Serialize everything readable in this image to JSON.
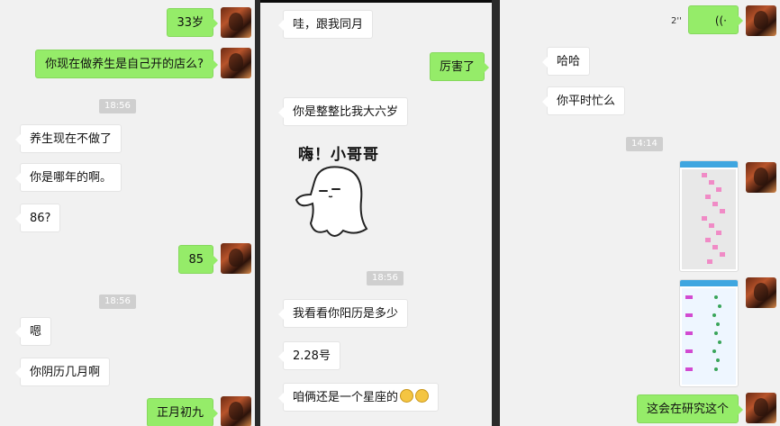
{
  "panel1": {
    "messages": [
      {
        "text": "33岁",
        "dir": "out"
      },
      {
        "text": "你现在做养生是自己开的店么?",
        "dir": "out"
      },
      {
        "text": "养生现在不做了",
        "dir": "in"
      },
      {
        "text": "你是哪年的啊。",
        "dir": "in"
      },
      {
        "text": "86?",
        "dir": "in"
      },
      {
        "text": "85",
        "dir": "out"
      },
      {
        "text": "嗯",
        "dir": "in"
      },
      {
        "text": "你阴历几月啊",
        "dir": "in"
      },
      {
        "text": "正月初九",
        "dir": "out"
      }
    ],
    "timestamps": [
      "18:56",
      "18:56"
    ]
  },
  "panel2": {
    "messages": [
      {
        "text": "哇，跟我同月",
        "dir": "in"
      },
      {
        "text": "厉害了",
        "dir": "out"
      },
      {
        "text": "你是整整比我大六岁",
        "dir": "in"
      },
      {
        "text": "我看看你阳历是多少",
        "dir": "in"
      },
      {
        "text": "2.28号",
        "dir": "in"
      },
      {
        "text": "咱俩还是一个星座的",
        "dir": "in"
      }
    ],
    "sticker_text": "嗨！小哥哥",
    "timestamps": [
      "18:56"
    ]
  },
  "panel3": {
    "voice_duration": "2''",
    "messages": [
      {
        "text": "哈哈",
        "dir": "in"
      },
      {
        "text": "你平时忙么",
        "dir": "in"
      },
      {
        "text": "这会在研究这个",
        "dir": "out"
      }
    ],
    "timestamps": [
      "14:14"
    ]
  },
  "colors": {
    "outgoing_bubble": "#95ec69",
    "incoming_bubble": "#ffffff",
    "chat_background": "#f1f1f1"
  }
}
